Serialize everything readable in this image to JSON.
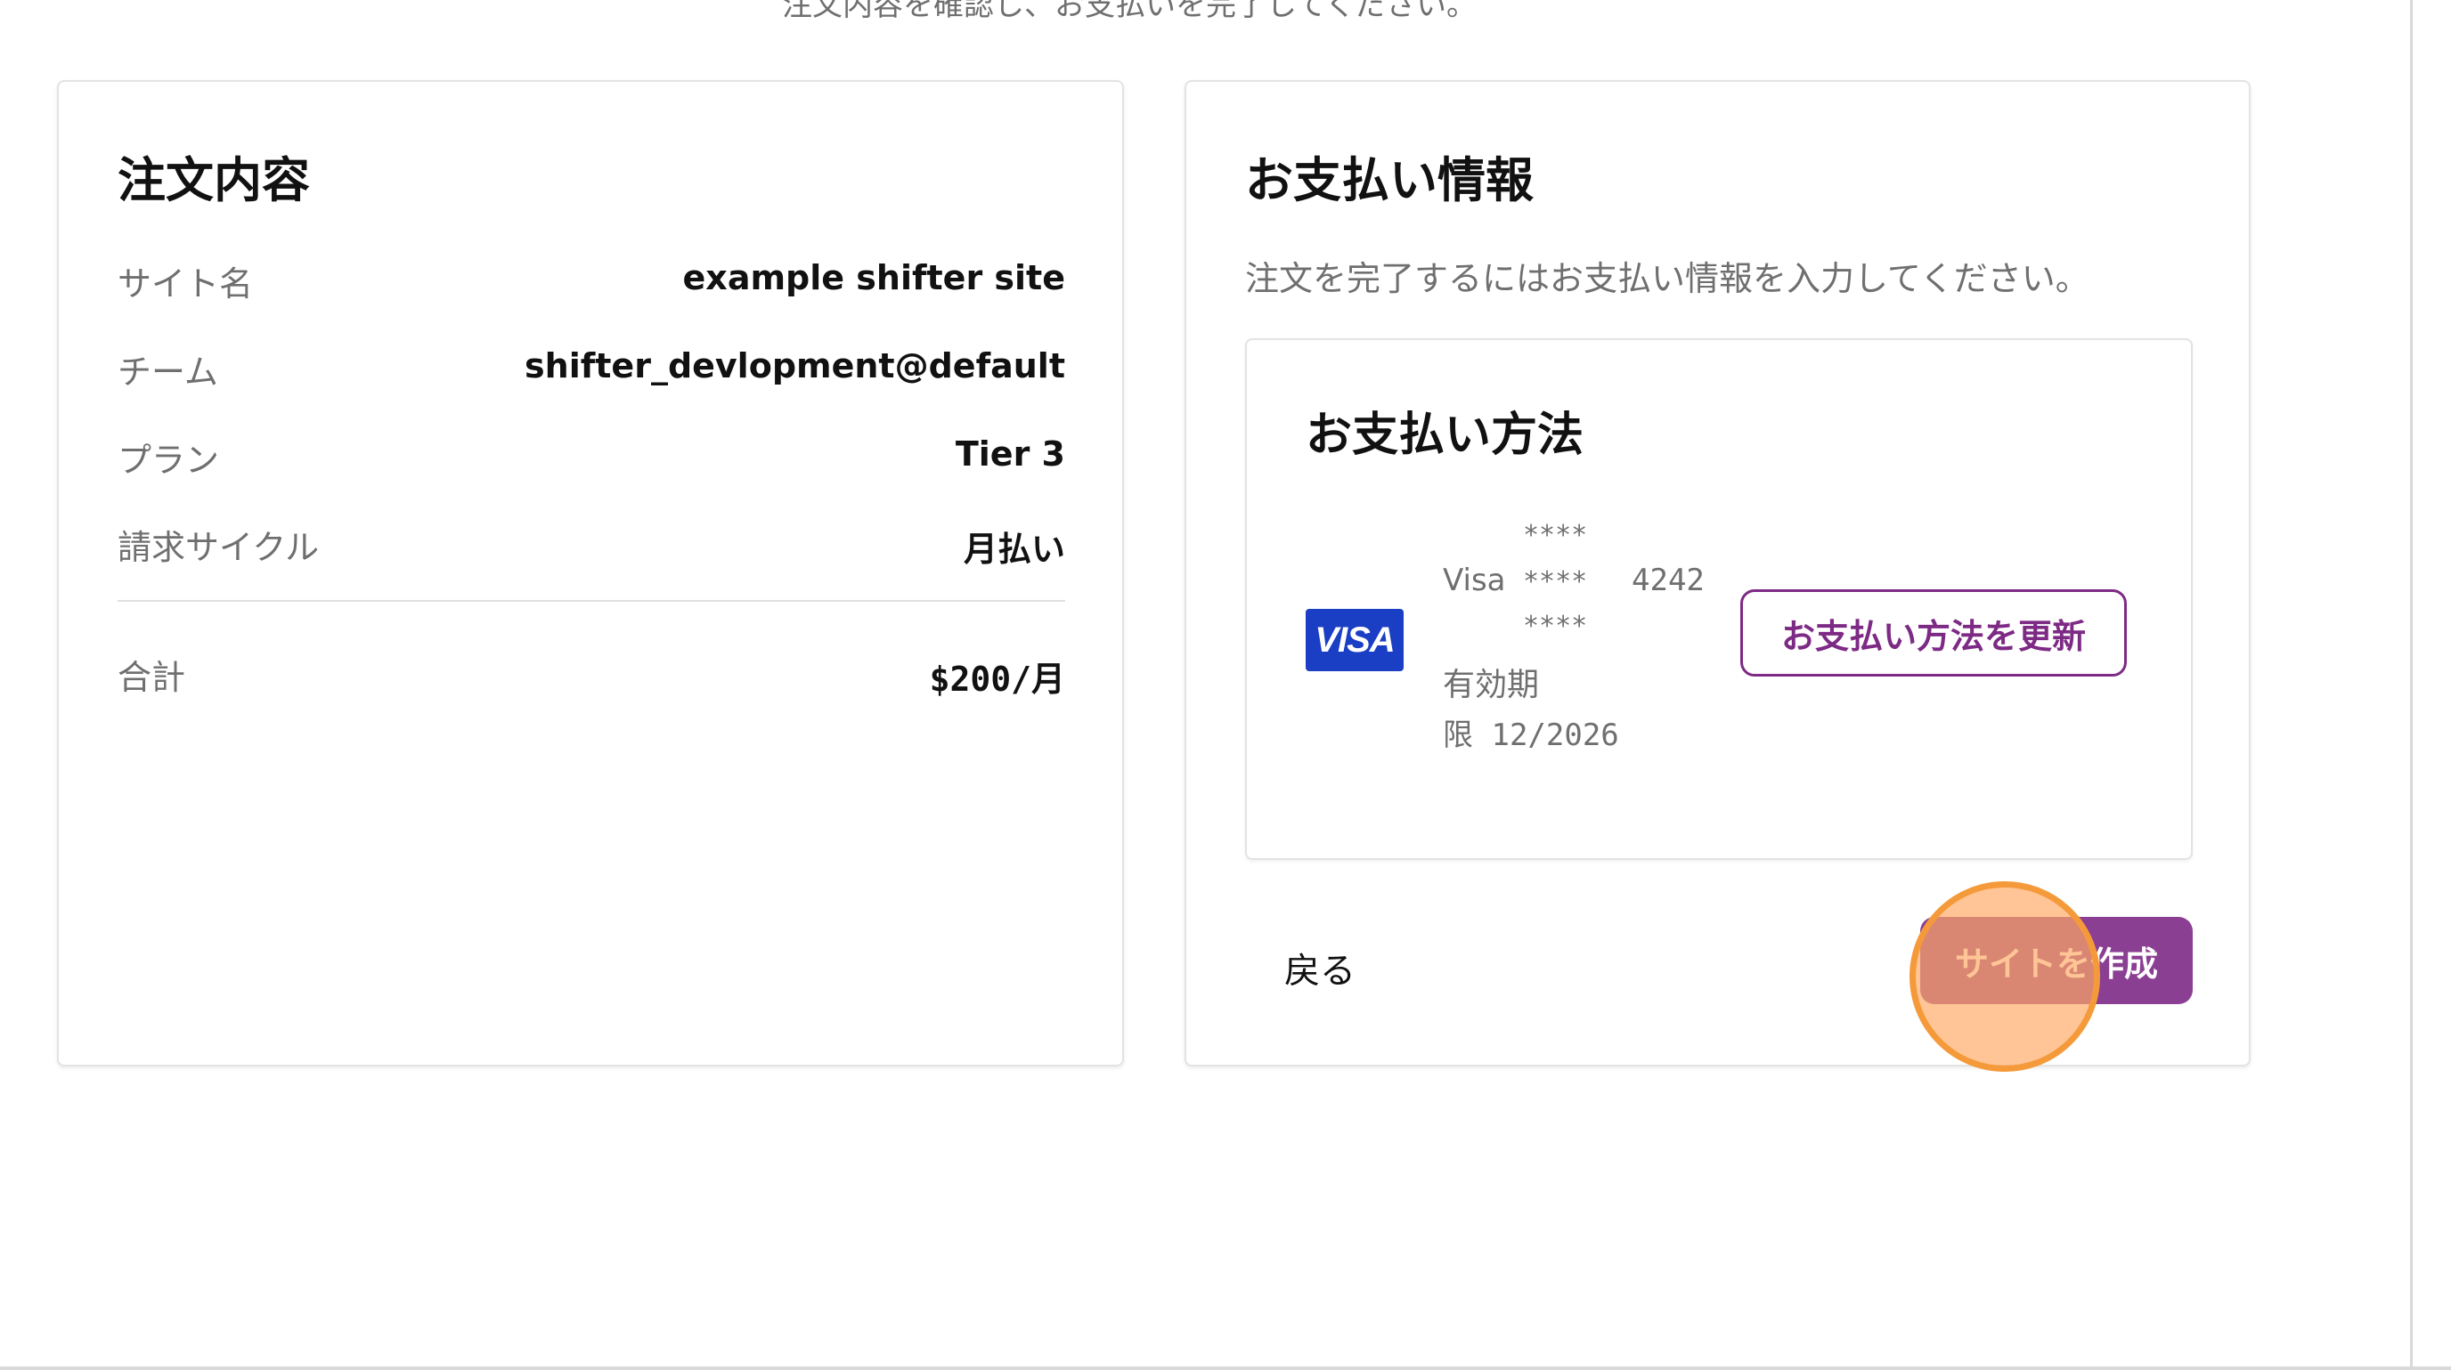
{
  "page": {
    "subtitle": "注文内容を確認し、お支払いを完了してください。"
  },
  "order": {
    "title": "注文内容",
    "rows": [
      {
        "label": "サイト名",
        "value": "example shifter site"
      },
      {
        "label": "チーム",
        "value": "shifter_devlopment@default"
      },
      {
        "label": "プラン",
        "value": "Tier 3"
      },
      {
        "label": "請求サイクル",
        "value": "月払い"
      }
    ],
    "total": {
      "label": "合計",
      "value": "$200/月"
    }
  },
  "payment": {
    "title": "お支払い情報",
    "description": "注文を完了するにはお支払い情報を入力してください。",
    "method": {
      "title": "お支払い方法",
      "logo_text": "VISA",
      "brand": "Visa",
      "mask": "****",
      "last4": "4242",
      "expiry_label": "有効期",
      "expiry_value": "限 12/2026",
      "update_label": "お支払い方法を更新"
    },
    "back_label": "戻る",
    "create_label": "サイトを作成"
  },
  "colors": {
    "accent": "#8a3f93",
    "accent_border": "#7d2a85",
    "visa_blue": "#1a3ec4",
    "click_indicator": "#f59a3a"
  }
}
